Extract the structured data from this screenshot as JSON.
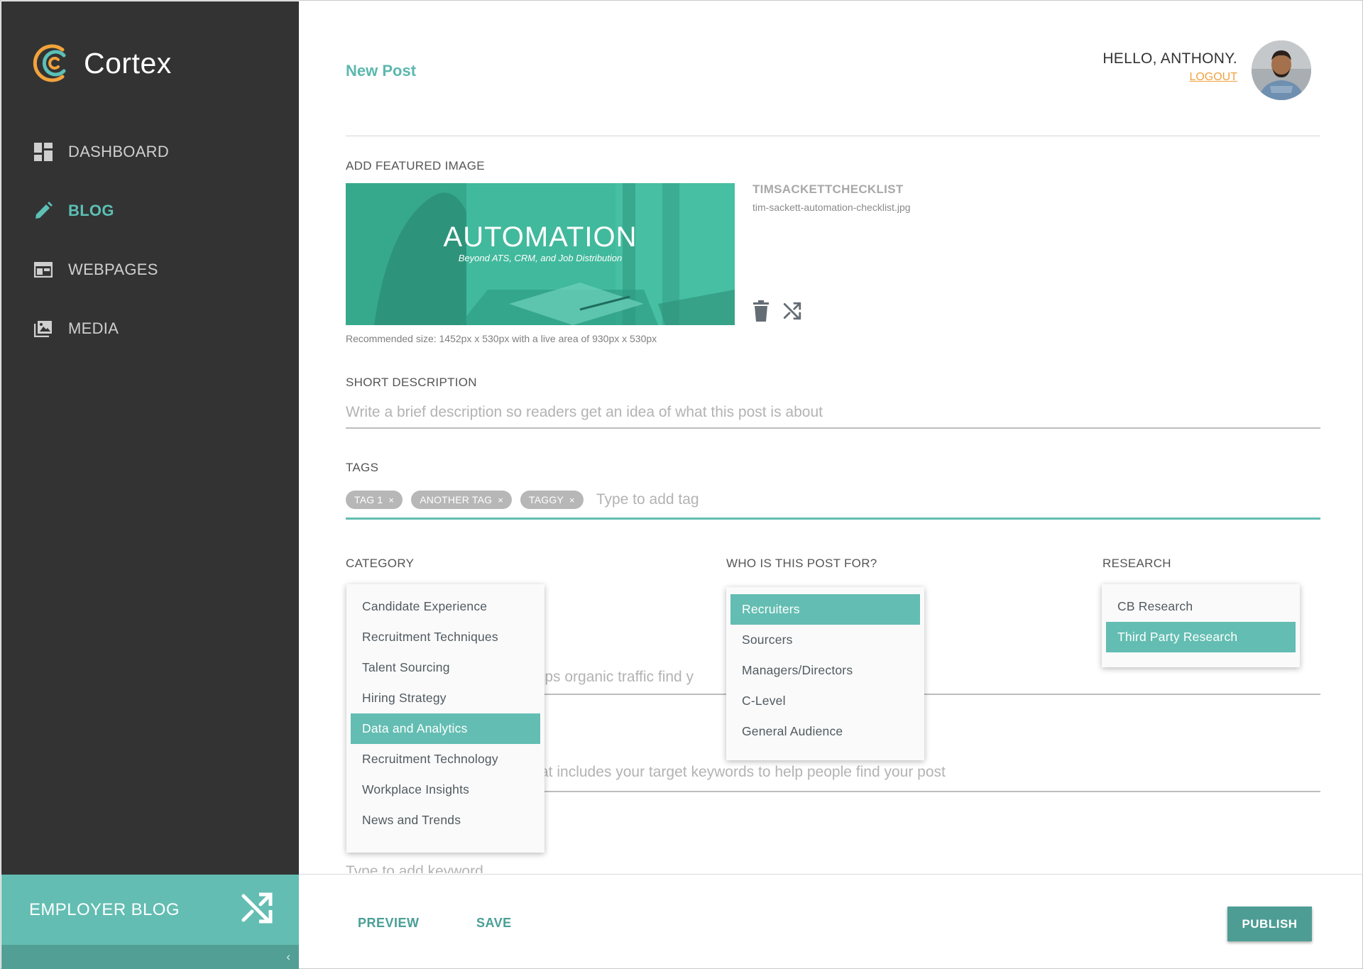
{
  "app": {
    "name": "Cortex"
  },
  "sidebar": {
    "items": [
      {
        "label": "DASHBOARD",
        "icon": "dashboard-icon",
        "active": false
      },
      {
        "label": "BLOG",
        "icon": "pencil-icon",
        "active": true
      },
      {
        "label": "WEBPAGES",
        "icon": "webpage-icon",
        "active": false
      },
      {
        "label": "MEDIA",
        "icon": "image-icon",
        "active": false
      }
    ],
    "switcher_label": "EMPLOYER BLOG",
    "collapse_glyph": "‹"
  },
  "header": {
    "page_title": "New Post",
    "greeting": "HELLO, ANTHONY.",
    "logout": "LOGOUT"
  },
  "featured_image": {
    "section_label": "ADD FEATURED IMAGE",
    "image_title": "AUTOMATION",
    "image_subtitle": "Beyond ATS, CRM, and Job Distribution",
    "name": "TIMSACKETTCHECKLIST",
    "filename": "tim-sackett-automation-checklist.jpg",
    "recommended": "Recommended size: 1452px x 530px with a live area of 930px x 530px"
  },
  "short_description": {
    "label": "SHORT DESCRIPTION",
    "placeholder": "Write a brief description so readers get an idea of what this post is about"
  },
  "tags": {
    "label": "TAGS",
    "items": [
      "TAG 1",
      "ANOTHER TAG",
      "TAGGY"
    ],
    "remove_glyph": "×",
    "placeholder": "Type to add tag"
  },
  "category": {
    "label": "CATEGORY",
    "options": [
      "Candidate Experience",
      "Recruitment Techniques",
      "Talent Sourcing",
      "Hiring Strategy",
      "Data and Analytics",
      "Recruitment Technology",
      "Workplace Insights",
      "News and Trends"
    ],
    "selected": "Data and Analytics"
  },
  "audience": {
    "label": "WHO IS THIS POST FOR?",
    "options": [
      "Recruiters",
      "Sourcers",
      "Managers/Directors",
      "C-Level",
      "General Audience"
    ],
    "selected": "Recruiters"
  },
  "research": {
    "label": "RESEARCH",
    "options": [
      "CB Research",
      "Third Party Research"
    ],
    "selected": "Third Party Research"
  },
  "hidden_fields": {
    "seo_fragment": "elps organic traffic find y",
    "meta_fragment": "at includes your target keywords to help people find your post",
    "keyword_placeholder": "Type to add keyword"
  },
  "footer": {
    "preview": "PREVIEW",
    "save": "SAVE",
    "publish": "PUBLISH"
  },
  "colors": {
    "accent": "#5cc0b5",
    "sidebar_bg": "#333333",
    "logout": "#f0a240",
    "publish_bg": "#4e9d94"
  }
}
